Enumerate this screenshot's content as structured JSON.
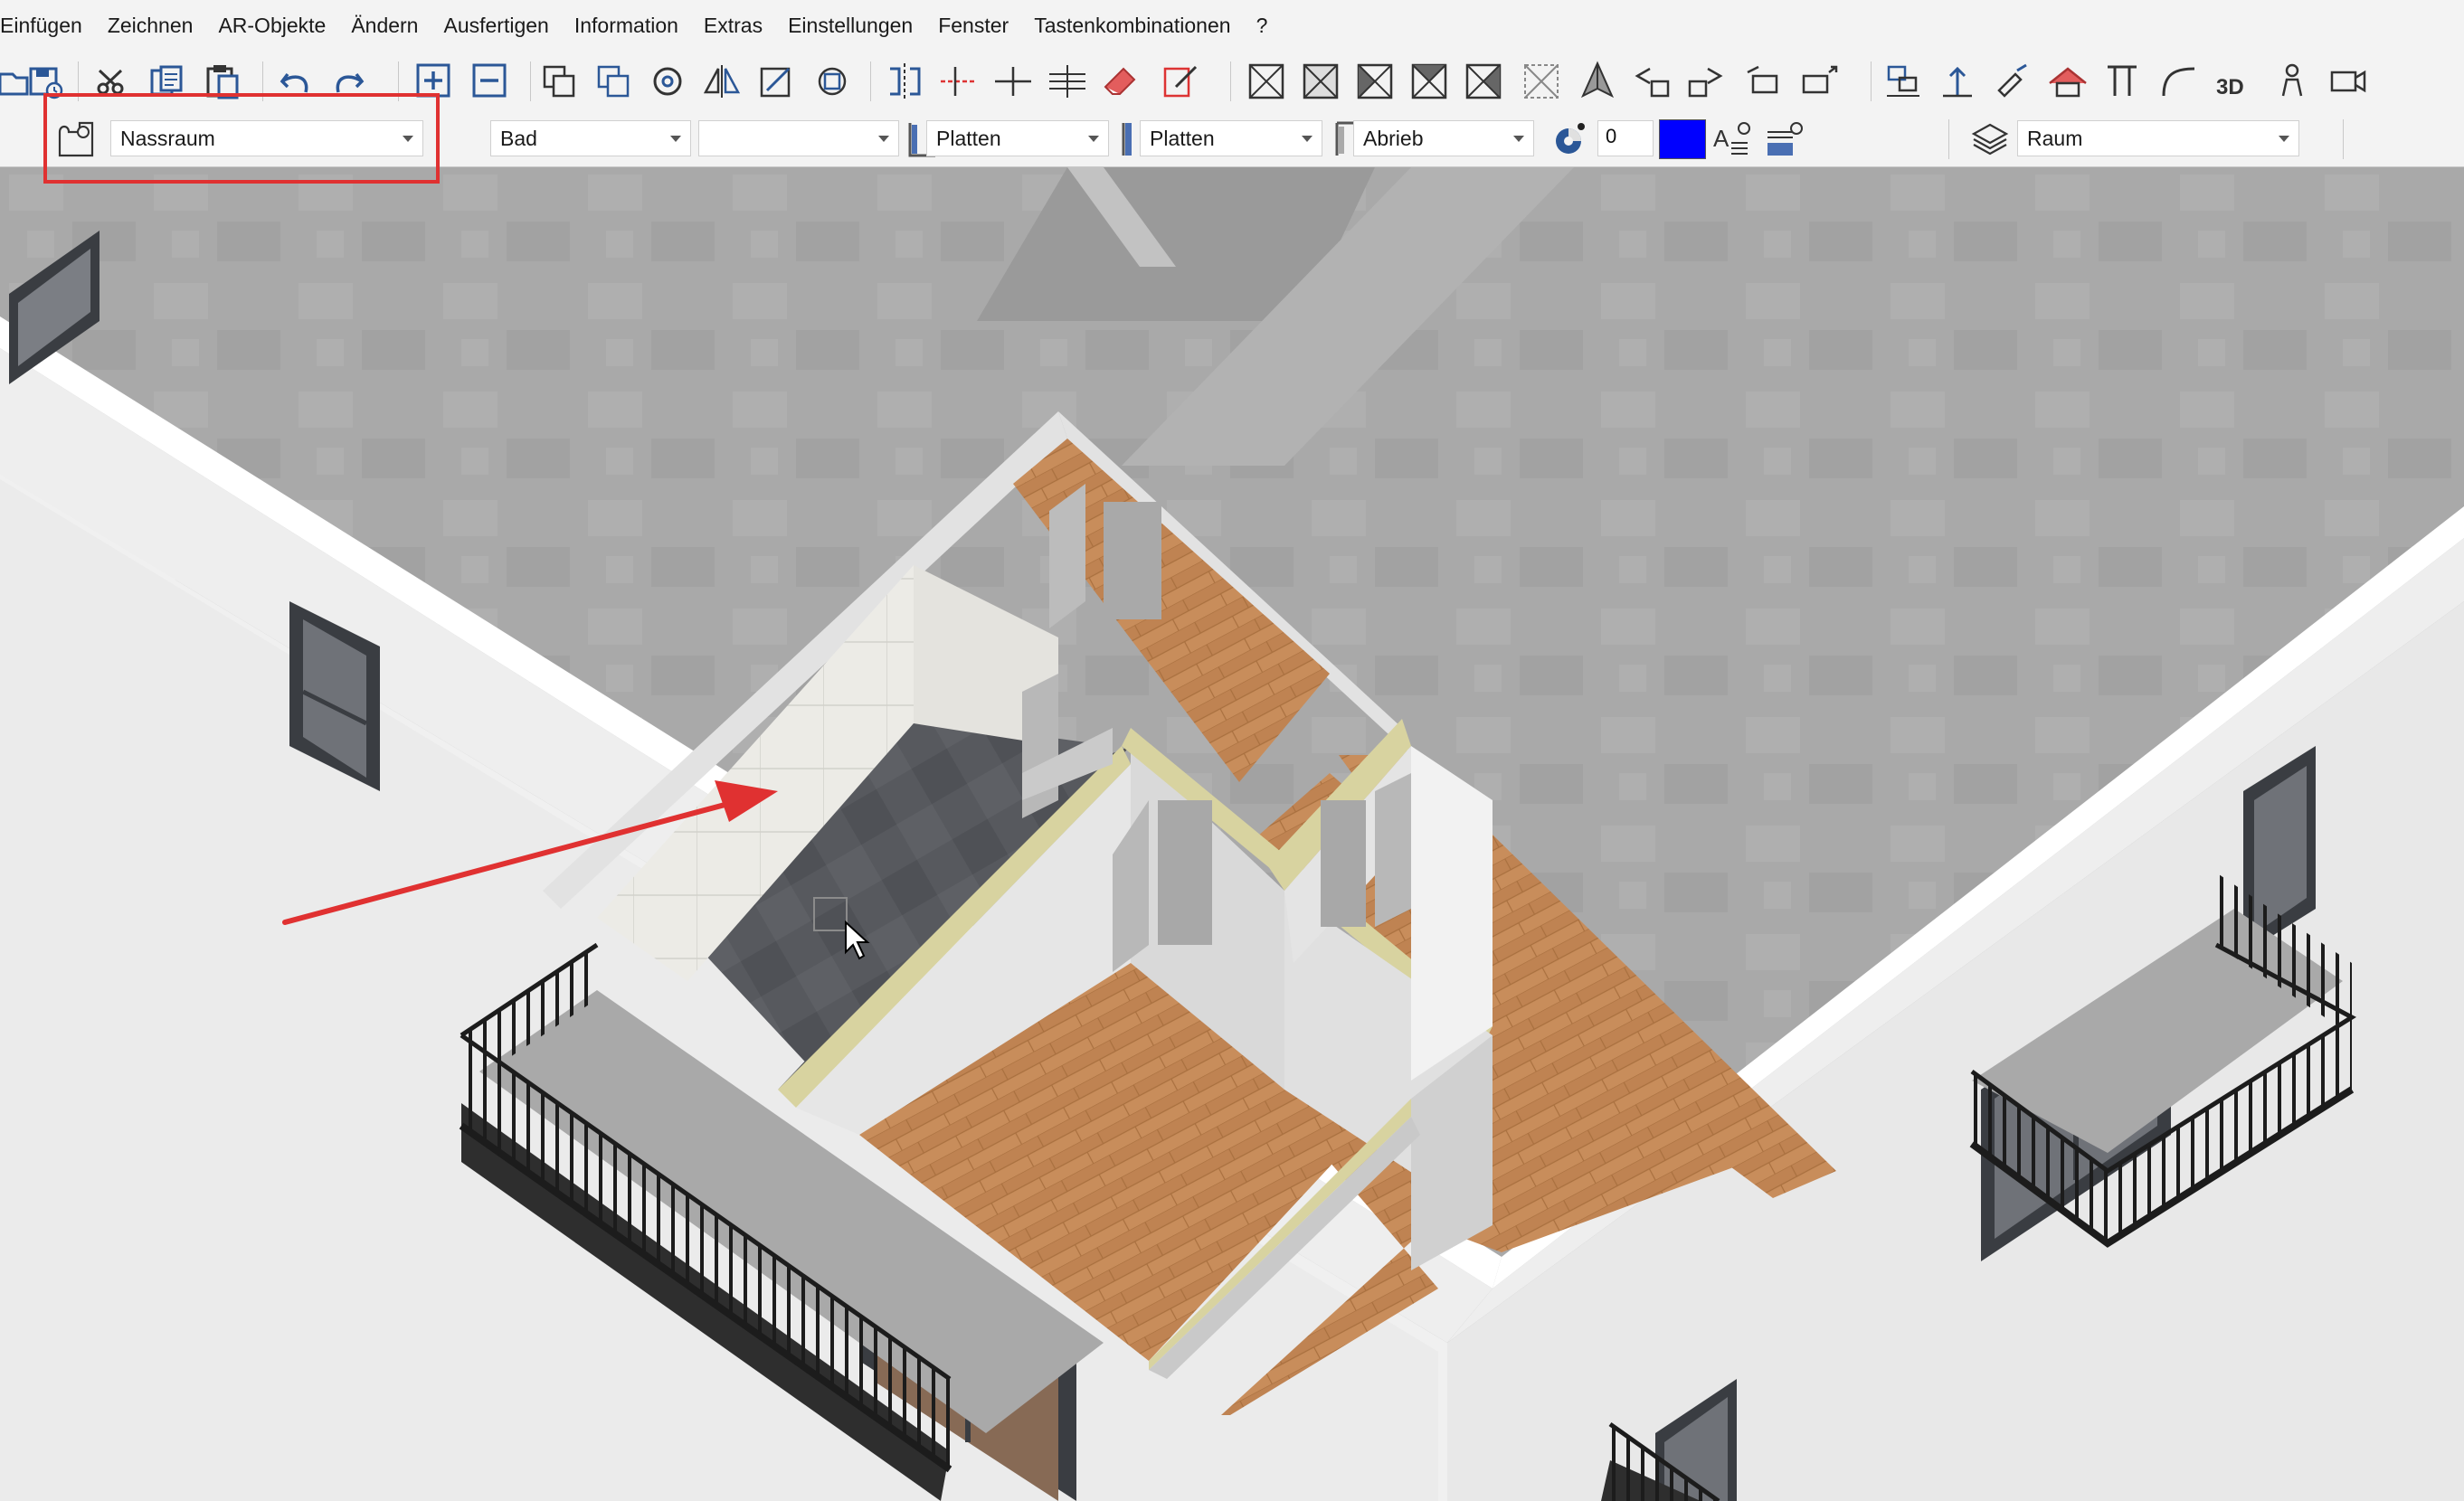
{
  "menu": {
    "items": [
      {
        "label": "Einfügen",
        "name": "menu-einfuegen"
      },
      {
        "label": "Zeichnen",
        "name": "menu-zeichnen"
      },
      {
        "label": "AR-Objekte",
        "name": "menu-ar-objekte"
      },
      {
        "label": "Ändern",
        "name": "menu-aendern"
      },
      {
        "label": "Ausfertigen",
        "name": "menu-ausfertigen"
      },
      {
        "label": "Information",
        "name": "menu-information"
      },
      {
        "label": "Extras",
        "name": "menu-extras"
      },
      {
        "label": "Einstellungen",
        "name": "menu-einstellungen"
      },
      {
        "label": "Fenster",
        "name": "menu-fenster"
      },
      {
        "label": "Tastenkombinationen",
        "name": "menu-tastenkombinationen"
      },
      {
        "label": "?",
        "name": "menu-help"
      }
    ]
  },
  "toolbar": {
    "view3d_label": "3D"
  },
  "properties": {
    "room_type": "Nassraum",
    "room_name": "Bad",
    "room_extra": "",
    "wall_finish": "Platten",
    "floor_finish": "Platten",
    "ceiling_finish": "Abrieb",
    "height_value": "0",
    "color_value": "#0000ff",
    "layer": "Raum"
  },
  "colors": {
    "highlight": "#e03131",
    "annotation_arrow": "#e03131",
    "parquet": "#c88d5b",
    "tiles": "#55585d",
    "wall": "#e4e4e4",
    "roof": "#a8a8a8"
  }
}
